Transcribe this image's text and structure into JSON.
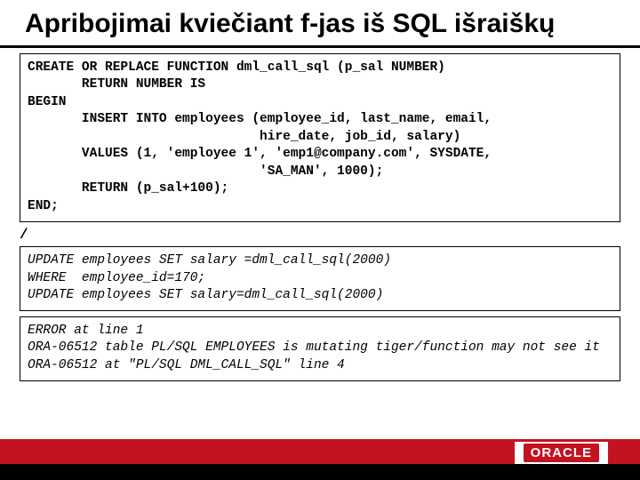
{
  "title": "Apribojimai kviečiant f-jas iš SQL išraiškų",
  "code1": "CREATE OR REPLACE FUNCTION dml_call_sql (p_sal NUMBER)\n       RETURN NUMBER IS\nBEGIN\n       INSERT INTO employees (employee_id, last_name, email,\n                              hire_date, job_id, salary)\n       VALUES (1, 'employee 1', 'emp1@company.com', SYSDATE,\n                              'SA_MAN', 1000);\n       RETURN (p_sal+100);\nEND;",
  "slash": "/",
  "code1_italic": "UPDATE employees SET salary =dml_call_sql(2000)\nWHERE  employee_id=170;\nUPDATE employees SET salary=dml_call_sql(2000)",
  "code2": "ERROR at line 1\nORA-06512 table PL/SQL EMPLOYEES is mutating tiger/function may not see it\nORA-06512 at \"PL/SQL DML_CALL_SQL\" line 4",
  "logo": "ORACLE"
}
